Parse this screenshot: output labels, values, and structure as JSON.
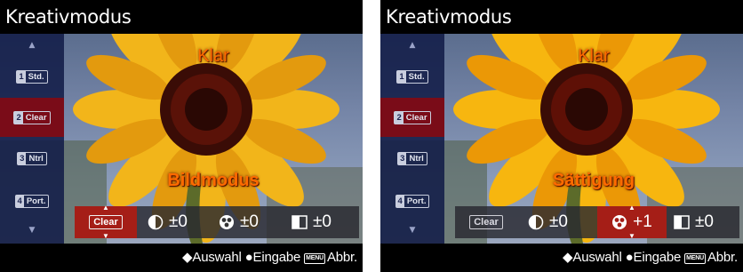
{
  "screens": [
    {
      "title": "Kreativmodus",
      "top_label": "Klar",
      "bottom_label": "Bildmodus",
      "sidebar": [
        "Std.",
        "Clear",
        "Ntrl",
        "Port."
      ],
      "sidebar_numbers": [
        "1",
        "2",
        "3",
        "4"
      ],
      "selected_sidebar": 1,
      "params": {
        "clear_tag": "Clear",
        "contrast": "±0",
        "saturation": "±0",
        "sharpness": "±0"
      },
      "selected_param": "clear",
      "footer": {
        "select": "Auswahl",
        "enter": "Eingabe",
        "menu_tag": "MENU",
        "cancel": "Abbr."
      }
    },
    {
      "title": "Kreativmodus",
      "top_label": "Klar",
      "bottom_label": "Sättigung",
      "sidebar": [
        "Std.",
        "Clear",
        "Ntrl",
        "Port."
      ],
      "sidebar_numbers": [
        "1",
        "2",
        "3",
        "4"
      ],
      "selected_sidebar": 1,
      "params": {
        "clear_tag": "Clear",
        "contrast": "±0",
        "saturation": "+1",
        "sharpness": "±0"
      },
      "selected_param": "saturation",
      "footer": {
        "select": "Auswahl",
        "enter": "Eingabe",
        "menu_tag": "MENU",
        "cancel": "Abbr."
      }
    }
  ],
  "colors": {
    "label_orange": "#ff6a00",
    "selected_red": "#a51e17",
    "sidebar_blue": "#121c48",
    "sidebar_selected": "#820a14"
  },
  "icons": [
    "contrast-icon",
    "saturation-icon",
    "sharpness-icon",
    "select-arrows-icon",
    "enter-dot-icon"
  ]
}
